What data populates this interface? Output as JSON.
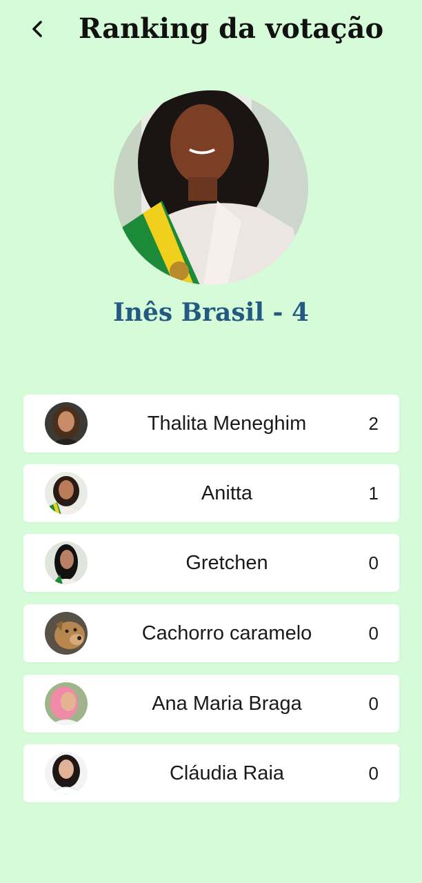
{
  "header": {
    "title": "Ranking da votação",
    "back_icon": "chevron-left-icon"
  },
  "winner": {
    "label": "Inês Brasil - 4",
    "avatar": "photo"
  },
  "ranking": [
    {
      "name": "Thalita Meneghim",
      "votes": "2"
    },
    {
      "name": "Anitta",
      "votes": "1"
    },
    {
      "name": "Gretchen",
      "votes": "0"
    },
    {
      "name": "Cachorro caramelo",
      "votes": "0"
    },
    {
      "name": "Ana Maria Braga",
      "votes": "0"
    },
    {
      "name": "Cláudia Raia",
      "votes": "0"
    }
  ],
  "colors": {
    "background": "#d5fbd8",
    "card": "#ffffff",
    "winner_text": "#245a82"
  }
}
